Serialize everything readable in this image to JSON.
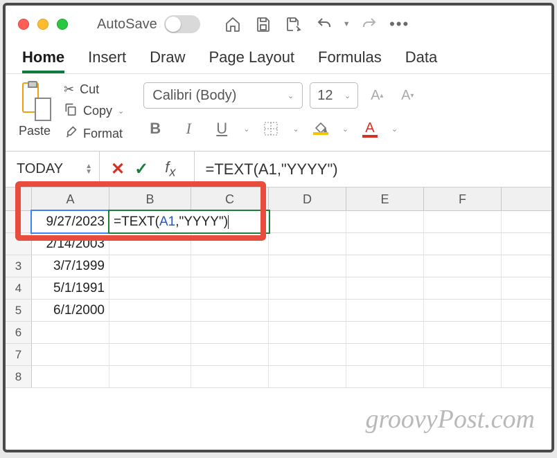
{
  "titlebar": {
    "autosave_label": "AutoSave"
  },
  "tabs": [
    "Home",
    "Insert",
    "Draw",
    "Page Layout",
    "Formulas",
    "Data"
  ],
  "active_tab": "Home",
  "ribbon": {
    "paste_label": "Paste",
    "cut_label": "Cut",
    "copy_label": "Copy",
    "format_label": "Format",
    "font_name": "Calibri (Body)",
    "font_size": "12",
    "buttons": {
      "B": "B",
      "I": "I",
      "U": "U",
      "A": "A"
    }
  },
  "namebox": "TODAY",
  "formula_bar": "=TEXT(A1,\"YYYY\")",
  "columns": [
    "A",
    "B",
    "C",
    "D",
    "E",
    "F"
  ],
  "grid": {
    "rows": [
      {
        "n": "",
        "A": "9/27/2023",
        "B_prefix": "=TEXT(",
        "B_ref": "A1",
        "B_suffix": ",\"YYYY\")"
      },
      {
        "n": "",
        "A": "2/14/2003"
      },
      {
        "n": "3",
        "A": "3/7/1999"
      },
      {
        "n": "4",
        "A": "5/1/1991"
      },
      {
        "n": "5",
        "A": "6/1/2000"
      },
      {
        "n": "6",
        "A": ""
      },
      {
        "n": "7",
        "A": ""
      },
      {
        "n": "8",
        "A": ""
      }
    ]
  },
  "watermark": "groovyPost.com"
}
